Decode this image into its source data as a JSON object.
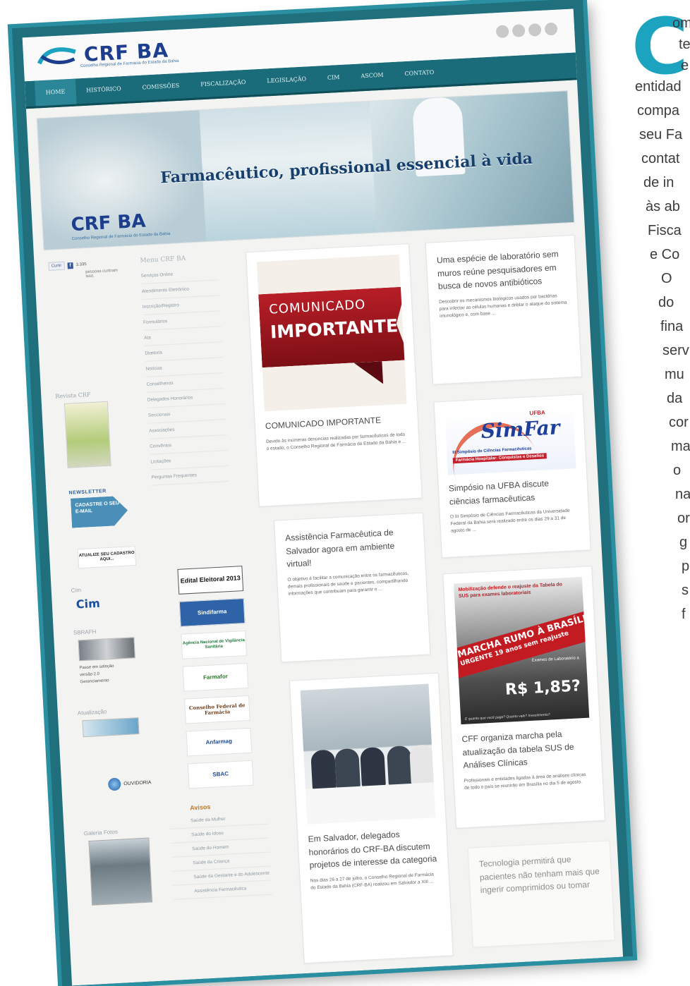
{
  "site": {
    "logo_text": "CRF BA",
    "logo_subtitle": "Conselho Regional de Farmácia do Estado da Bahia",
    "nav": [
      "HOME",
      "HISTÓRICO",
      "COMISSÕES",
      "FISCALIZAÇÃO",
      "LEGISLAÇÃO",
      "CIM",
      "ASCOM",
      "CONTATO"
    ],
    "banner": {
      "tagline": "Farmacêutico, profissional essencial à vida",
      "logo_text": "CRF BA",
      "logo_subtitle": "Conselho Regional de Farmácia do Estado da Bahia"
    },
    "left": {
      "like_label": "Curtir",
      "like_count": "3.335",
      "like_text": "pessoas curtiram isso.",
      "revista_title": "Revista CRF",
      "newsletter_title": "NEWSLETTER",
      "newsletter_cta": "CADASTRE O SEU E-MAIL",
      "atualize": "ATUALIZE SEU CADASTRO AQUI...",
      "cim_title": "Cim",
      "cim_logo": "Cim",
      "sbrafh_title": "SBRAFH",
      "note_1": "Passe em seleção",
      "note_2": "versão 2.0",
      "note_3": "Gerenciamento",
      "ouvidoria": "OUVIDORIA",
      "acervo_title": "Galeria Fotos",
      "videos_title": "Atualização"
    },
    "menu": {
      "title": "Menu CRF BA",
      "items": [
        "Serviços Online",
        "Atendimento Eletrônico",
        "Inscrição/Registro",
        "Formulários",
        "Ata",
        "Diretoria",
        "Notícias",
        "Conselheiros",
        "Delegados Honorários",
        "Seccionais",
        "Associações",
        "Convênios",
        "Licitações",
        "Perguntas Frequentes"
      ],
      "logos": [
        "Edital Eleitoral 2013",
        "Sindifarma",
        "Agência Nacional de Vigilância Sanitária",
        "Farmafor",
        "Conselho Federal de Farmácia",
        "Anfarmag",
        "SBAC"
      ],
      "avisos_title": "Avisos",
      "avisos": [
        "Saúde da Mulher",
        "Saúde do Idoso",
        "Saúde do Homem",
        "Saúde da Criança",
        "Saúde da Gestante e do Adolescente",
        "Assistência Farmacêutica"
      ]
    },
    "cards": {
      "comunicado": {
        "line1": "COMUNICADO",
        "line2": "IMPORTANTE",
        "title": "COMUNICADO IMPORTANTE",
        "excerpt": "Devido às inúmeras denúncias realizadas por farmacêuticos de todo o estado, o Conselho Regional de Farmácia do Estado da Bahia e ..."
      },
      "laboratorio": {
        "title": "Uma espécie de laboratório sem muros reúne pesquisadores em busca de novos antibióticos",
        "excerpt": "Descobrir os mecanismos biológicos usados por bactérias para infectar as células humanas e driblar o ataque do sistema imunológico e, com base ..."
      },
      "simfar": {
        "brand": "SimFar",
        "org": "UFBA",
        "subtitle": "III Simpósio de Ciências Farmacêuticas",
        "theme": "Farmácia Hospitalar: Conquistas e Desafios",
        "title": "Simpósio na UFBA discute ciências farmacêuticas",
        "excerpt": "O III Simpósio de Ciências Farmacêuticas da Universidade Federal da Bahia será realizado entre os dias 29 a 31 de agosto de ..."
      },
      "assistencia": {
        "title": "Assistência Farmacêutica de Salvador agora em ambiente virtual!",
        "excerpt": "O objetivo é facilitar a comunicação entre os farmacêuticos, demais profissionais de saúde e pacientes, compartilhando informações que contribuam para garantir o ..."
      },
      "marcha": {
        "header": "Mobilização defende o reajuste da Tabela do SUS para exames laboratoriais",
        "banner": "MARCHA RUMO À BRASÍLIA",
        "urgente": "URGENTE 19 anos sem reajuste",
        "exames": "Exames de Laboratório a",
        "price": "R$ 1,85?",
        "footnote": "E quanto que você paga? Quanto vale? Investimento?",
        "title": "CFF organiza marcha pela atualização da tabela SUS de Análises Clínicas",
        "excerpt": "Profissionais e entidades ligadas à área de análises clínicas de todo o país se reunirão em Brasília no dia 5 de agosto."
      },
      "delegados": {
        "title": "Em Salvador, delegados honorários do CRF-BA discutem projetos de interesse da categoria",
        "excerpt": "Nos dias 26 a 27 de julho, o Conselho Regional de Farmácia do Estado da Bahia (CRF-BA) realizou em Salvador a XIII ..."
      },
      "tecnologia": {
        "title": "Tecnologia permitirá que pacientes não tenham mais que ingerir comprimidos ou tomar"
      }
    }
  },
  "side_text": {
    "dropcap": "C",
    "lines": [
      "om",
      "te",
      "e",
      "entidad",
      "compa",
      "seu Fa",
      "contat",
      "de in",
      "às ab",
      "Fisca",
      "e Co",
      "O",
      "do",
      "fina",
      "serv",
      "mu",
      "da",
      "cor",
      "ma",
      "o",
      "na",
      "or",
      "g",
      "p",
      "s",
      "f"
    ]
  }
}
